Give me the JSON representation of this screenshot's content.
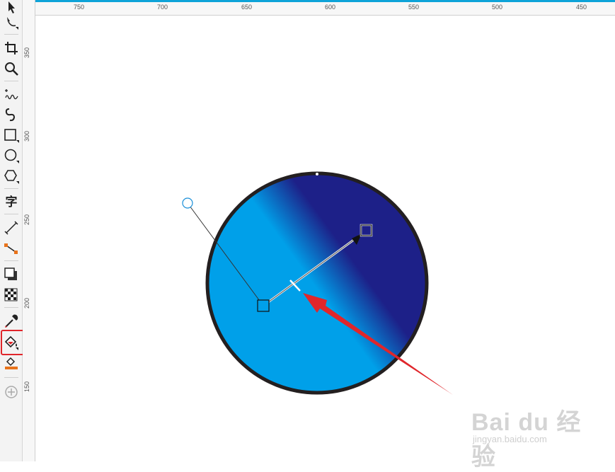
{
  "toolbar": {
    "tools": [
      {
        "name": "pick-tool-icon"
      },
      {
        "name": "shape-tool-icon"
      },
      {
        "name": "crop-tool-icon"
      },
      {
        "name": "zoom-tool-icon"
      },
      {
        "name": "freehand-tool-icon"
      },
      {
        "name": "artistic-media-icon"
      },
      {
        "name": "rectangle-tool-icon"
      },
      {
        "name": "ellipse-tool-icon"
      },
      {
        "name": "polygon-tool-icon"
      },
      {
        "name": "text-tool-icon",
        "label": "字"
      },
      {
        "name": "dimension-tool-icon"
      },
      {
        "name": "connector-tool-icon"
      },
      {
        "name": "drop-shadow-tool-icon"
      },
      {
        "name": "transparency-tool-icon"
      },
      {
        "name": "eyedropper-tool-icon"
      },
      {
        "name": "interactive-fill-tool-icon",
        "selected": true
      },
      {
        "name": "smart-fill-tool-icon"
      },
      {
        "name": "add-tool-icon"
      }
    ]
  },
  "ruler": {
    "horizontal_labels": [
      "750",
      "700",
      "650",
      "600",
      "550",
      "500",
      "450"
    ],
    "vertical_labels": [
      "350",
      "300",
      "250",
      "200",
      "150"
    ]
  },
  "fill": {
    "start_color": "#00a0e9",
    "end_color": "#1d2088",
    "outline_color": "#231f20"
  },
  "annotation": {
    "arrow_color": "#e0262b",
    "highlight_color": "#e0262b"
  },
  "watermark": {
    "brand": "Bai du 经验",
    "url": "jingyan.baidu.com"
  }
}
